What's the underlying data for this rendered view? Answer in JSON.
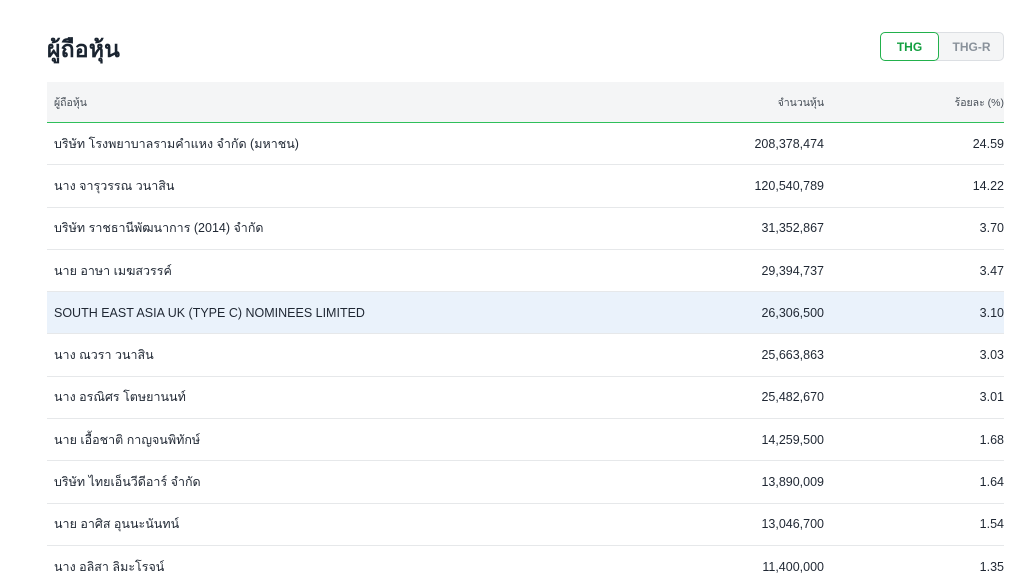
{
  "header": {
    "title": "ผู้ถือหุ้น",
    "tabs": [
      {
        "label": "THG",
        "active": true
      },
      {
        "label": "THG-R",
        "active": false
      }
    ]
  },
  "colors": {
    "accent": "#22b14c",
    "highlight_row": "#eaf2fb",
    "header_bg": "#f4f5f6"
  },
  "table": {
    "columns": [
      "ผู้ถือหุ้น",
      "จำนวนหุ้น",
      "ร้อยละ (%)"
    ],
    "rows": [
      {
        "name": "บริษัท โรงพยาบาลรามคำแหง จำกัด (มหาชน)",
        "shares": "208,378,474",
        "percent": "24.59"
      },
      {
        "name": "นาง จารุวรรณ วนาสิน",
        "shares": "120,540,789",
        "percent": "14.22"
      },
      {
        "name": "บริษัท ราชธานีพัฒนาการ (2014) จำกัด",
        "shares": "31,352,867",
        "percent": "3.70"
      },
      {
        "name": "นาย อาษา เมฆสวรรค์",
        "shares": "29,394,737",
        "percent": "3.47"
      },
      {
        "name": "SOUTH EAST ASIA UK (TYPE C) NOMINEES LIMITED",
        "shares": "26,306,500",
        "percent": "3.10"
      },
      {
        "name": "นาง ณวรา วนาสิน",
        "shares": "25,663,863",
        "percent": "3.03"
      },
      {
        "name": "นาง อรณิศร โตษยานนท์",
        "shares": "25,482,670",
        "percent": "3.01"
      },
      {
        "name": "นาย เอื้อชาติ กาญจนพิทักษ์",
        "shares": "14,259,500",
        "percent": "1.68"
      },
      {
        "name": "บริษัท ไทยเอ็นวีดีอาร์ จำกัด",
        "shares": "13,890,009",
        "percent": "1.64"
      },
      {
        "name": "นาย อาศิส อุนนะนันทน์",
        "shares": "13,046,700",
        "percent": "1.54"
      },
      {
        "name": "นาง อลิสา ลิมะโรจน์",
        "shares": "11,400,000",
        "percent": "1.35"
      }
    ]
  }
}
